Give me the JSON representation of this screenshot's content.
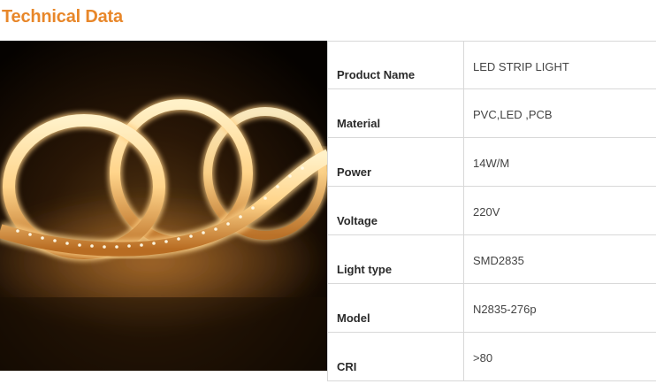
{
  "header": {
    "title": "Technical Data"
  },
  "photo": {
    "subject": "LED strip light coil"
  },
  "specs": [
    {
      "label": "Product Name",
      "value": "LED STRIP LIGHT"
    },
    {
      "label": "Material",
      "value": "PVC,LED ,PCB"
    },
    {
      "label": "Power",
      "value": "14W/M"
    },
    {
      "label": "Voltage",
      "value": "220V"
    },
    {
      "label": "Light type",
      "value": "SMD2835"
    },
    {
      "label": "Model",
      "value": "N2835-276p"
    },
    {
      "label": "CRI",
      "value": ">80"
    }
  ],
  "colors": {
    "title": "#e8872a",
    "border": "#d8d8d8",
    "glow": "#ffd58a"
  }
}
